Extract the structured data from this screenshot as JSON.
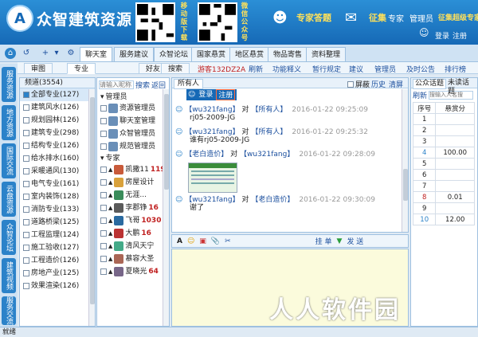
{
  "header": {
    "logo_mark": "A",
    "app_title": "众智建筑资源",
    "qr1_caption": "移动版下载",
    "qr2_caption": "微信公众号",
    "expert_label": "专家答题",
    "recruit_label": "征集",
    "expert_link": "专家",
    "admin_link": "管理员",
    "recruit_expert_link": "征集超级专家",
    "login": "登录",
    "register": "注册"
  },
  "nav": {
    "tabs": [
      "聊天室",
      "服务建议",
      "众智论坛",
      "国家悬赏",
      "地区悬赏",
      "物品寄售",
      "资料整理"
    ],
    "active": 0
  },
  "subtabs": {
    "tabs": [
      "审图",
      "专业",
      "好友",
      "搜索"
    ],
    "active": 1,
    "user_tag": "游客132DZ2A",
    "links": [
      "刷新",
      "功能释义",
      "暂行规定",
      "建议",
      "管理员",
      "及时公告",
      "排行榜"
    ]
  },
  "vtabs": [
    "服务资源",
    "地方资源",
    "国际交流",
    "云盘资源",
    "众智论坛",
    "建筑视频",
    "服务交流"
  ],
  "channels": {
    "header": "频道(3554)",
    "items": [
      {
        "label": "全部专业(127)",
        "selected": true
      },
      {
        "label": "建筑风水(126)"
      },
      {
        "label": "规划园林(126)"
      },
      {
        "label": "建筑专业(298)"
      },
      {
        "label": "结构专业(126)"
      },
      {
        "label": "给水排水(160)"
      },
      {
        "label": "采暖通风(130)"
      },
      {
        "label": "电气专业(161)"
      },
      {
        "label": "室内装饰(128)"
      },
      {
        "label": "消防专业(133)"
      },
      {
        "label": "道路桥梁(125)"
      },
      {
        "label": "工程监理(124)"
      },
      {
        "label": "施工验收(127)"
      },
      {
        "label": "工程造价(126)"
      },
      {
        "label": "房地产业(125)"
      },
      {
        "label": "效果渲染(126)"
      }
    ]
  },
  "users": {
    "search_placeholder": "请输入昵称",
    "search_btn": "搜索",
    "back_btn": "返回",
    "admin_group": "管理员",
    "admins": [
      "资源管理员",
      "聊天室管理",
      "众智管理员",
      "规范管理员"
    ],
    "expert_group": "专家",
    "experts": [
      {
        "name": "凯撒11",
        "score": "119"
      },
      {
        "name": "房屋设计",
        "score": ""
      },
      {
        "name": "无涯...",
        "score": ""
      },
      {
        "name": "李郡铮",
        "score": "16"
      },
      {
        "name": "飞哥",
        "score": "1030"
      },
      {
        "name": "大鹏",
        "score": "16"
      },
      {
        "name": "清风天宁",
        "score": ""
      },
      {
        "name": "慕容大圣",
        "score": ""
      },
      {
        "name": "夏晓光",
        "score": "64"
      }
    ]
  },
  "chat": {
    "tab": "所有人",
    "options": [
      "屏蔽",
      "历史",
      "清屏"
    ],
    "popup_login": "登录",
    "popup_register": "注册",
    "messages": [
      {
        "from": "wu321fang",
        "to": "所有人",
        "time": "2016-01-22 09:25:09",
        "lines": [
          "rj05-2009-JG"
        ]
      },
      {
        "from": "wu321fang",
        "to": "所有人",
        "time": "2016-01-22 09:25:32",
        "lines": [
          "谁有rj05-2009-JG"
        ]
      },
      {
        "from": "老白造价",
        "to": "wu321fang",
        "time": "2016-01-22 09:28:09",
        "lines": []
      },
      {
        "from": "wu321fang",
        "to": "老白造价",
        "time": "2016-01-22 09:30:09",
        "lines": [
          "谢了"
        ]
      }
    ],
    "send_btn": "发 送",
    "hang_btn": "挂 单"
  },
  "right": {
    "tabs": [
      "公众话题",
      "未读话题"
    ],
    "refresh": "刷新",
    "search_placeholder": "搜输入人名搜",
    "columns": [
      "序号",
      "悬赏分"
    ],
    "rows": [
      [
        "1",
        ""
      ],
      [
        "2",
        ""
      ],
      [
        "3",
        ""
      ],
      [
        "4",
        "100.00"
      ],
      [
        "5",
        ""
      ],
      [
        "6",
        ""
      ],
      [
        "7",
        ""
      ],
      [
        "8",
        "0.01"
      ],
      [
        "9",
        ""
      ],
      [
        "10",
        "12.00"
      ]
    ]
  },
  "status": {
    "text": "就绪",
    "watermark": "人人软件园"
  },
  "colors": {
    "header": "#1669b6",
    "accent": "#ffe15a",
    "link": "#1b4f9e"
  }
}
